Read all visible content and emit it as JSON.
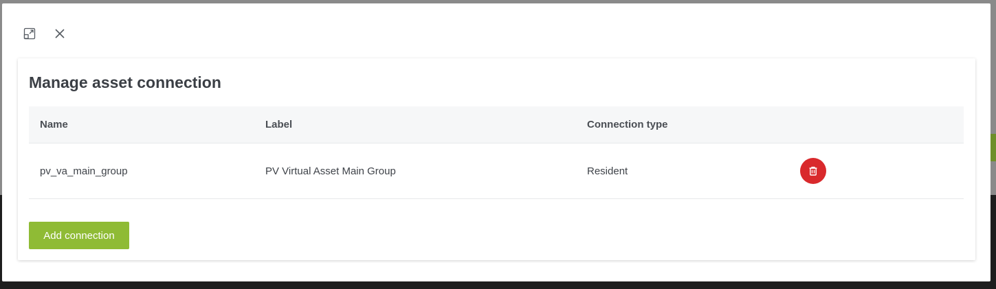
{
  "modal": {
    "title": "Manage asset connection",
    "icons": {
      "expand": "expand-icon",
      "close": "close-icon"
    }
  },
  "table": {
    "headers": {
      "name": "Name",
      "label": "Label",
      "type": "Connection type"
    },
    "rows": [
      {
        "name": "pv_va_main_group",
        "label": "PV Virtual Asset Main Group",
        "type": "Resident",
        "action_icon": "trash-icon"
      }
    ]
  },
  "actions": {
    "add_connection": "Add connection"
  },
  "colors": {
    "accent": "#8fbb35",
    "danger": "#d9292c",
    "header_bg": "#f6f7f8",
    "title_text": "#3b3f45"
  }
}
